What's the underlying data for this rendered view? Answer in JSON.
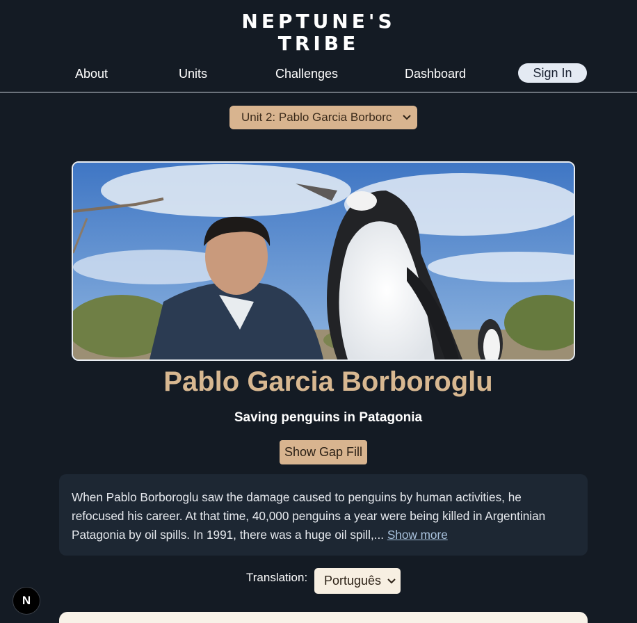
{
  "brand": {
    "line1": "NEPTUNE'S",
    "line2": "TRIBE"
  },
  "nav": {
    "about": "About",
    "units": "Units",
    "challenges": "Challenges",
    "dashboard": "Dashboard",
    "sign_in": "Sign In"
  },
  "unit_select": {
    "selected": "Unit 2: Pablo Garcia Borborc"
  },
  "hero": {
    "alt": "Pablo Garcia Borboroglu with penguin"
  },
  "profile": {
    "name": "Pablo Garcia Borboroglu",
    "tagline": "Saving penguins in Patagonia",
    "gap_fill_button": "Show Gap Fill",
    "story": "When Pablo Borboroglu saw the damage caused to penguins by human activities, he refocused his career. At that time, 40,000 penguins a year were being killed in Argentinian Patagonia by oil spills. In 1991, there was a huge oil spill,...",
    "show_more": "Show more"
  },
  "translation": {
    "label": "Translation:",
    "selected": "Português"
  },
  "badge": {
    "letter": "N"
  },
  "colors": {
    "background": "#141b24",
    "accent": "#d8b48f",
    "title": "#d8b891",
    "card": "#1d2733"
  },
  "icons": [
    "chevron-down-icon",
    "next-logo-icon"
  ]
}
